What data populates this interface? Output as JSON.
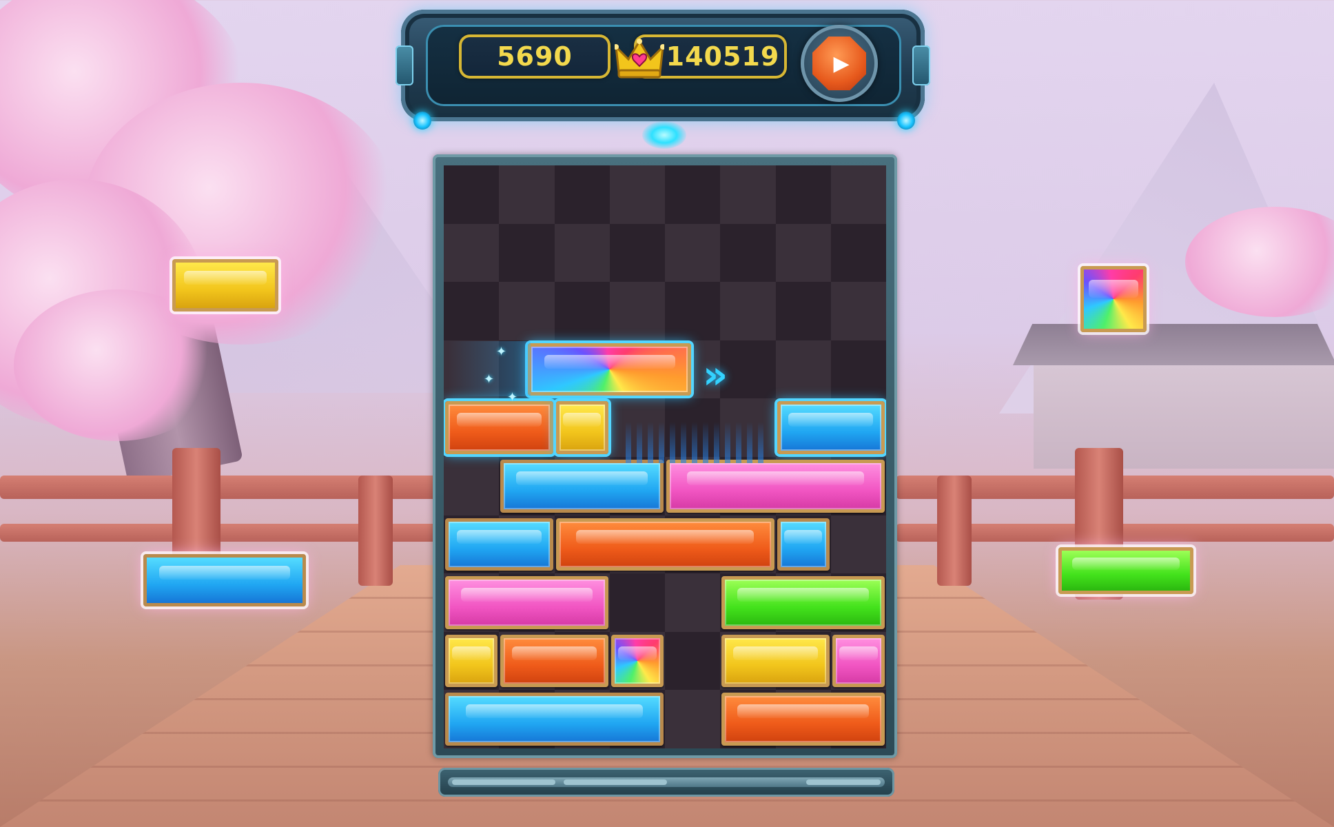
{
  "hud": {
    "score": "5690",
    "best_score": "140519",
    "play_button_icon": "play-icon"
  },
  "board": {
    "columns": 8,
    "rows": 10,
    "blocks": [
      {
        "row": 3,
        "col": 1.5,
        "len": 3,
        "color": "rainbow",
        "active": true
      },
      {
        "row": 4,
        "col": 0,
        "len": 2,
        "color": "orange",
        "active": true
      },
      {
        "row": 4,
        "col": 2,
        "len": 1,
        "color": "yellow",
        "active": true
      },
      {
        "row": 4,
        "col": 6,
        "len": 2,
        "color": "blue",
        "active": true
      },
      {
        "row": 5,
        "col": 1,
        "len": 3,
        "color": "blue"
      },
      {
        "row": 5,
        "col": 4,
        "len": 4,
        "color": "pink"
      },
      {
        "row": 6,
        "col": 0,
        "len": 2,
        "color": "blue"
      },
      {
        "row": 6,
        "col": 2,
        "len": 4,
        "color": "orange"
      },
      {
        "row": 6,
        "col": 6,
        "len": 1,
        "color": "blue"
      },
      {
        "row": 7,
        "col": 0,
        "len": 3,
        "color": "pink"
      },
      {
        "row": 7,
        "col": 5,
        "len": 3,
        "color": "green"
      },
      {
        "row": 8,
        "col": 0,
        "len": 1,
        "color": "yellow"
      },
      {
        "row": 8,
        "col": 1,
        "len": 2,
        "color": "orange"
      },
      {
        "row": 8,
        "col": 3,
        "len": 1,
        "color": "rainbow"
      },
      {
        "row": 8,
        "col": 5,
        "len": 2,
        "color": "yellow"
      },
      {
        "row": 8,
        "col": 7,
        "len": 1,
        "color": "pink"
      },
      {
        "row": 9,
        "col": 0,
        "len": 4,
        "color": "blue"
      },
      {
        "row": 9,
        "col": 5,
        "len": 3,
        "color": "orange"
      }
    ]
  },
  "decorations": {
    "left_top": {
      "color": "yellow"
    },
    "left_bottom": {
      "color": "blue"
    },
    "right_top": {
      "color": "rainbow"
    },
    "right_bottom": {
      "color": "green"
    }
  },
  "progress": {
    "value": 1.0
  },
  "colors": {
    "score_text": "#f3d94d",
    "accent_glow": "#2ec5ff",
    "board_bg": "#302731"
  }
}
